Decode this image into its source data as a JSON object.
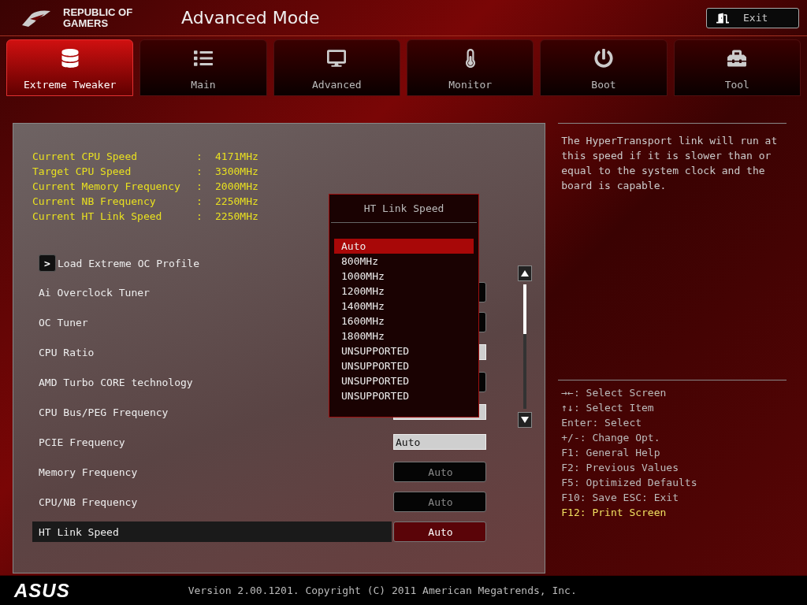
{
  "header": {
    "brand": "REPUBLIC OF GAMERS",
    "title": "Advanced Mode",
    "exit_button": "Exit"
  },
  "tabs": [
    {
      "label": "Extreme Tweaker",
      "selected": true
    },
    {
      "label": "Main",
      "selected": false
    },
    {
      "label": "Advanced",
      "selected": false
    },
    {
      "label": "Monitor",
      "selected": false
    },
    {
      "label": "Boot",
      "selected": false
    },
    {
      "label": "Tool",
      "selected": false
    }
  ],
  "info": [
    {
      "label": "Current CPU Speed",
      "value": "4171MHz"
    },
    {
      "label": "Target CPU Speed",
      "value": "3300MHz"
    },
    {
      "label": "Current Memory Frequency",
      "value": "2000MHz"
    },
    {
      "label": "Current NB Frequency",
      "value": "2250MHz"
    },
    {
      "label": "Current HT Link Speed",
      "value": "2250MHz"
    }
  ],
  "separator": ":",
  "submenu": {
    "label": "Load Extreme OC Profile",
    "arrow": ">"
  },
  "settings": [
    {
      "label": "Ai Overclock Tuner",
      "kind": "select",
      "selected": false
    },
    {
      "label": "OC Tuner",
      "kind": "select",
      "selected": false
    },
    {
      "label": "CPU Ratio",
      "kind": "input",
      "selected": false
    },
    {
      "label": "AMD Turbo CORE technology",
      "kind": "select",
      "selected": false
    },
    {
      "label": "CPU Bus/PEG Frequency",
      "kind": "input",
      "selected": false
    },
    {
      "label": "PCIE Frequency",
      "kind": "input",
      "value": "Auto",
      "selected": false
    },
    {
      "label": "Memory Frequency",
      "kind": "select",
      "value": "Auto",
      "selected": false
    },
    {
      "label": "CPU/NB Frequency",
      "kind": "select",
      "value": "Auto",
      "selected": false
    },
    {
      "label": "HT Link Speed",
      "kind": "select",
      "value": "Auto",
      "selected": true
    }
  ],
  "popup": {
    "title": "HT Link Speed",
    "options": [
      {
        "label": "Auto",
        "selected": true
      },
      {
        "label": "800MHz",
        "selected": false
      },
      {
        "label": "1000MHz",
        "selected": false
      },
      {
        "label": "1200MHz",
        "selected": false
      },
      {
        "label": "1400MHz",
        "selected": false
      },
      {
        "label": "1600MHz",
        "selected": false
      },
      {
        "label": "1800MHz",
        "selected": false
      },
      {
        "label": "UNSUPPORTED",
        "selected": false
      },
      {
        "label": "UNSUPPORTED",
        "selected": false
      },
      {
        "label": "UNSUPPORTED",
        "selected": false
      },
      {
        "label": "UNSUPPORTED",
        "selected": false
      }
    ]
  },
  "help": "The HyperTransport link will run at this speed if it is slower than or equal to the system clock and the board is capable.",
  "keys": [
    {
      "text": "→←: Select Screen",
      "highlighted": false
    },
    {
      "text": "↑↓: Select Item",
      "highlighted": false
    },
    {
      "text": "Enter: Select",
      "highlighted": false
    },
    {
      "text": "+/-: Change Opt.",
      "highlighted": false
    },
    {
      "text": "F1: General Help",
      "highlighted": false
    },
    {
      "text": "F2: Previous Values",
      "highlighted": false
    },
    {
      "text": "F5: Optimized Defaults",
      "highlighted": false
    },
    {
      "text": "F10: Save  ESC: Exit",
      "highlighted": false
    },
    {
      "text": "F12: Print Screen",
      "highlighted": true
    }
  ],
  "footer": {
    "logo": "ASUS",
    "version": "Version 2.00.1201. Copyright (C) 2011 American Megatrends, Inc."
  }
}
